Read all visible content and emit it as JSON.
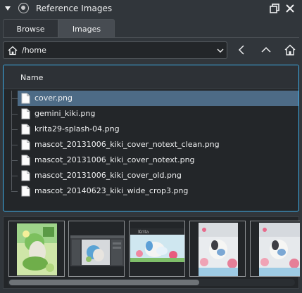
{
  "docker": {
    "title": "Reference Images",
    "icons": {
      "collapse": "triangle-down-icon",
      "logo": "krita-logo-icon",
      "float": "float-window-icon",
      "close": "close-icon"
    }
  },
  "tabs": [
    {
      "label": "Browse",
      "active": false
    },
    {
      "label": "Images",
      "active": true
    }
  ],
  "path": {
    "value": "/home",
    "icons": {
      "home": "home-icon",
      "dropdown": "chevron-down-icon"
    }
  },
  "nav": {
    "back": "chevron-left-icon",
    "up": "chevron-up-icon",
    "home": "home-icon"
  },
  "filelist": {
    "header": "Name",
    "files": [
      {
        "name": "cover.png",
        "selected": true
      },
      {
        "name": "gemini_kiki.png",
        "selected": false
      },
      {
        "name": "krita29-splash-04.png",
        "selected": false
      },
      {
        "name": "mascot_20131006_kiki_cover_notext_clean.png",
        "selected": false
      },
      {
        "name": "mascot_20131006_kiki_cover_notext.png",
        "selected": false
      },
      {
        "name": "mascot_20131006_kiki_cover_old.png",
        "selected": false
      },
      {
        "name": "mascot_20140623_kiki_wide_crop3.png",
        "selected": false
      }
    ]
  },
  "thumbnails": {
    "items": [
      "cover-thumbnail",
      "gemini-kiki-thumbnail",
      "krita-splash-thumbnail",
      "kiki-cover-notext-clean-thumbnail",
      "kiki-cover-notext-thumbnail"
    ],
    "scroll_position": 0.66
  },
  "colors": {
    "accent": "#3daee9",
    "selection": "#4d6b86",
    "panel": "#31363b",
    "view": "#232629"
  }
}
